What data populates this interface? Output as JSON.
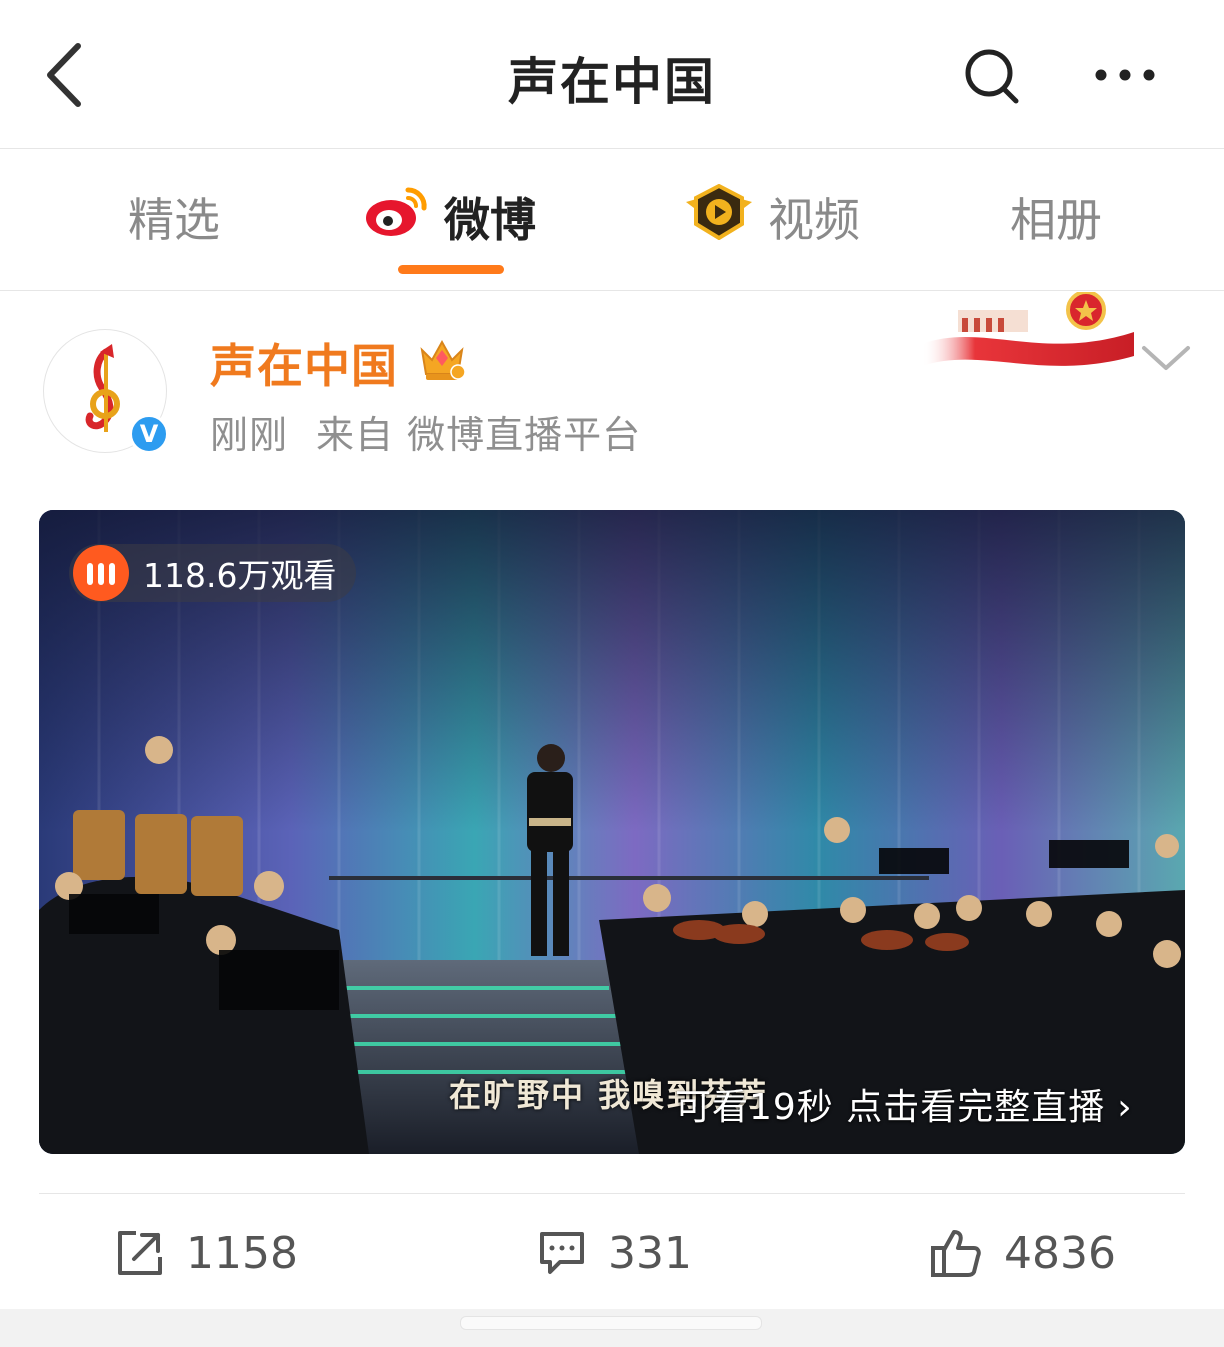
{
  "header": {
    "title": "声在中国"
  },
  "tabs": [
    {
      "label": "精选",
      "icon": "none",
      "active": false
    },
    {
      "label": "微博",
      "icon": "weibo-logo-icon",
      "active": true
    },
    {
      "label": "视频",
      "icon": "video-badge-icon",
      "active": false
    },
    {
      "label": "相册",
      "icon": "none",
      "active": false
    }
  ],
  "post": {
    "author": "声在中国",
    "verified_badge": "V",
    "time": "刚刚",
    "source": "来自 微博直播平台"
  },
  "video": {
    "views": "118.6万观看",
    "subtitle": "在旷野中 我嗅到芬芳",
    "watch_prompt": "可看19秒 点击看完整直播",
    "watch_arrow": "›"
  },
  "actions": {
    "reposts": "1158",
    "comments": "331",
    "likes": "4836"
  },
  "colors": {
    "accent": "#ff7a1a",
    "author_name": "#f07a1e",
    "verify": "#2d9cf0",
    "live": "#ff5a1f"
  }
}
